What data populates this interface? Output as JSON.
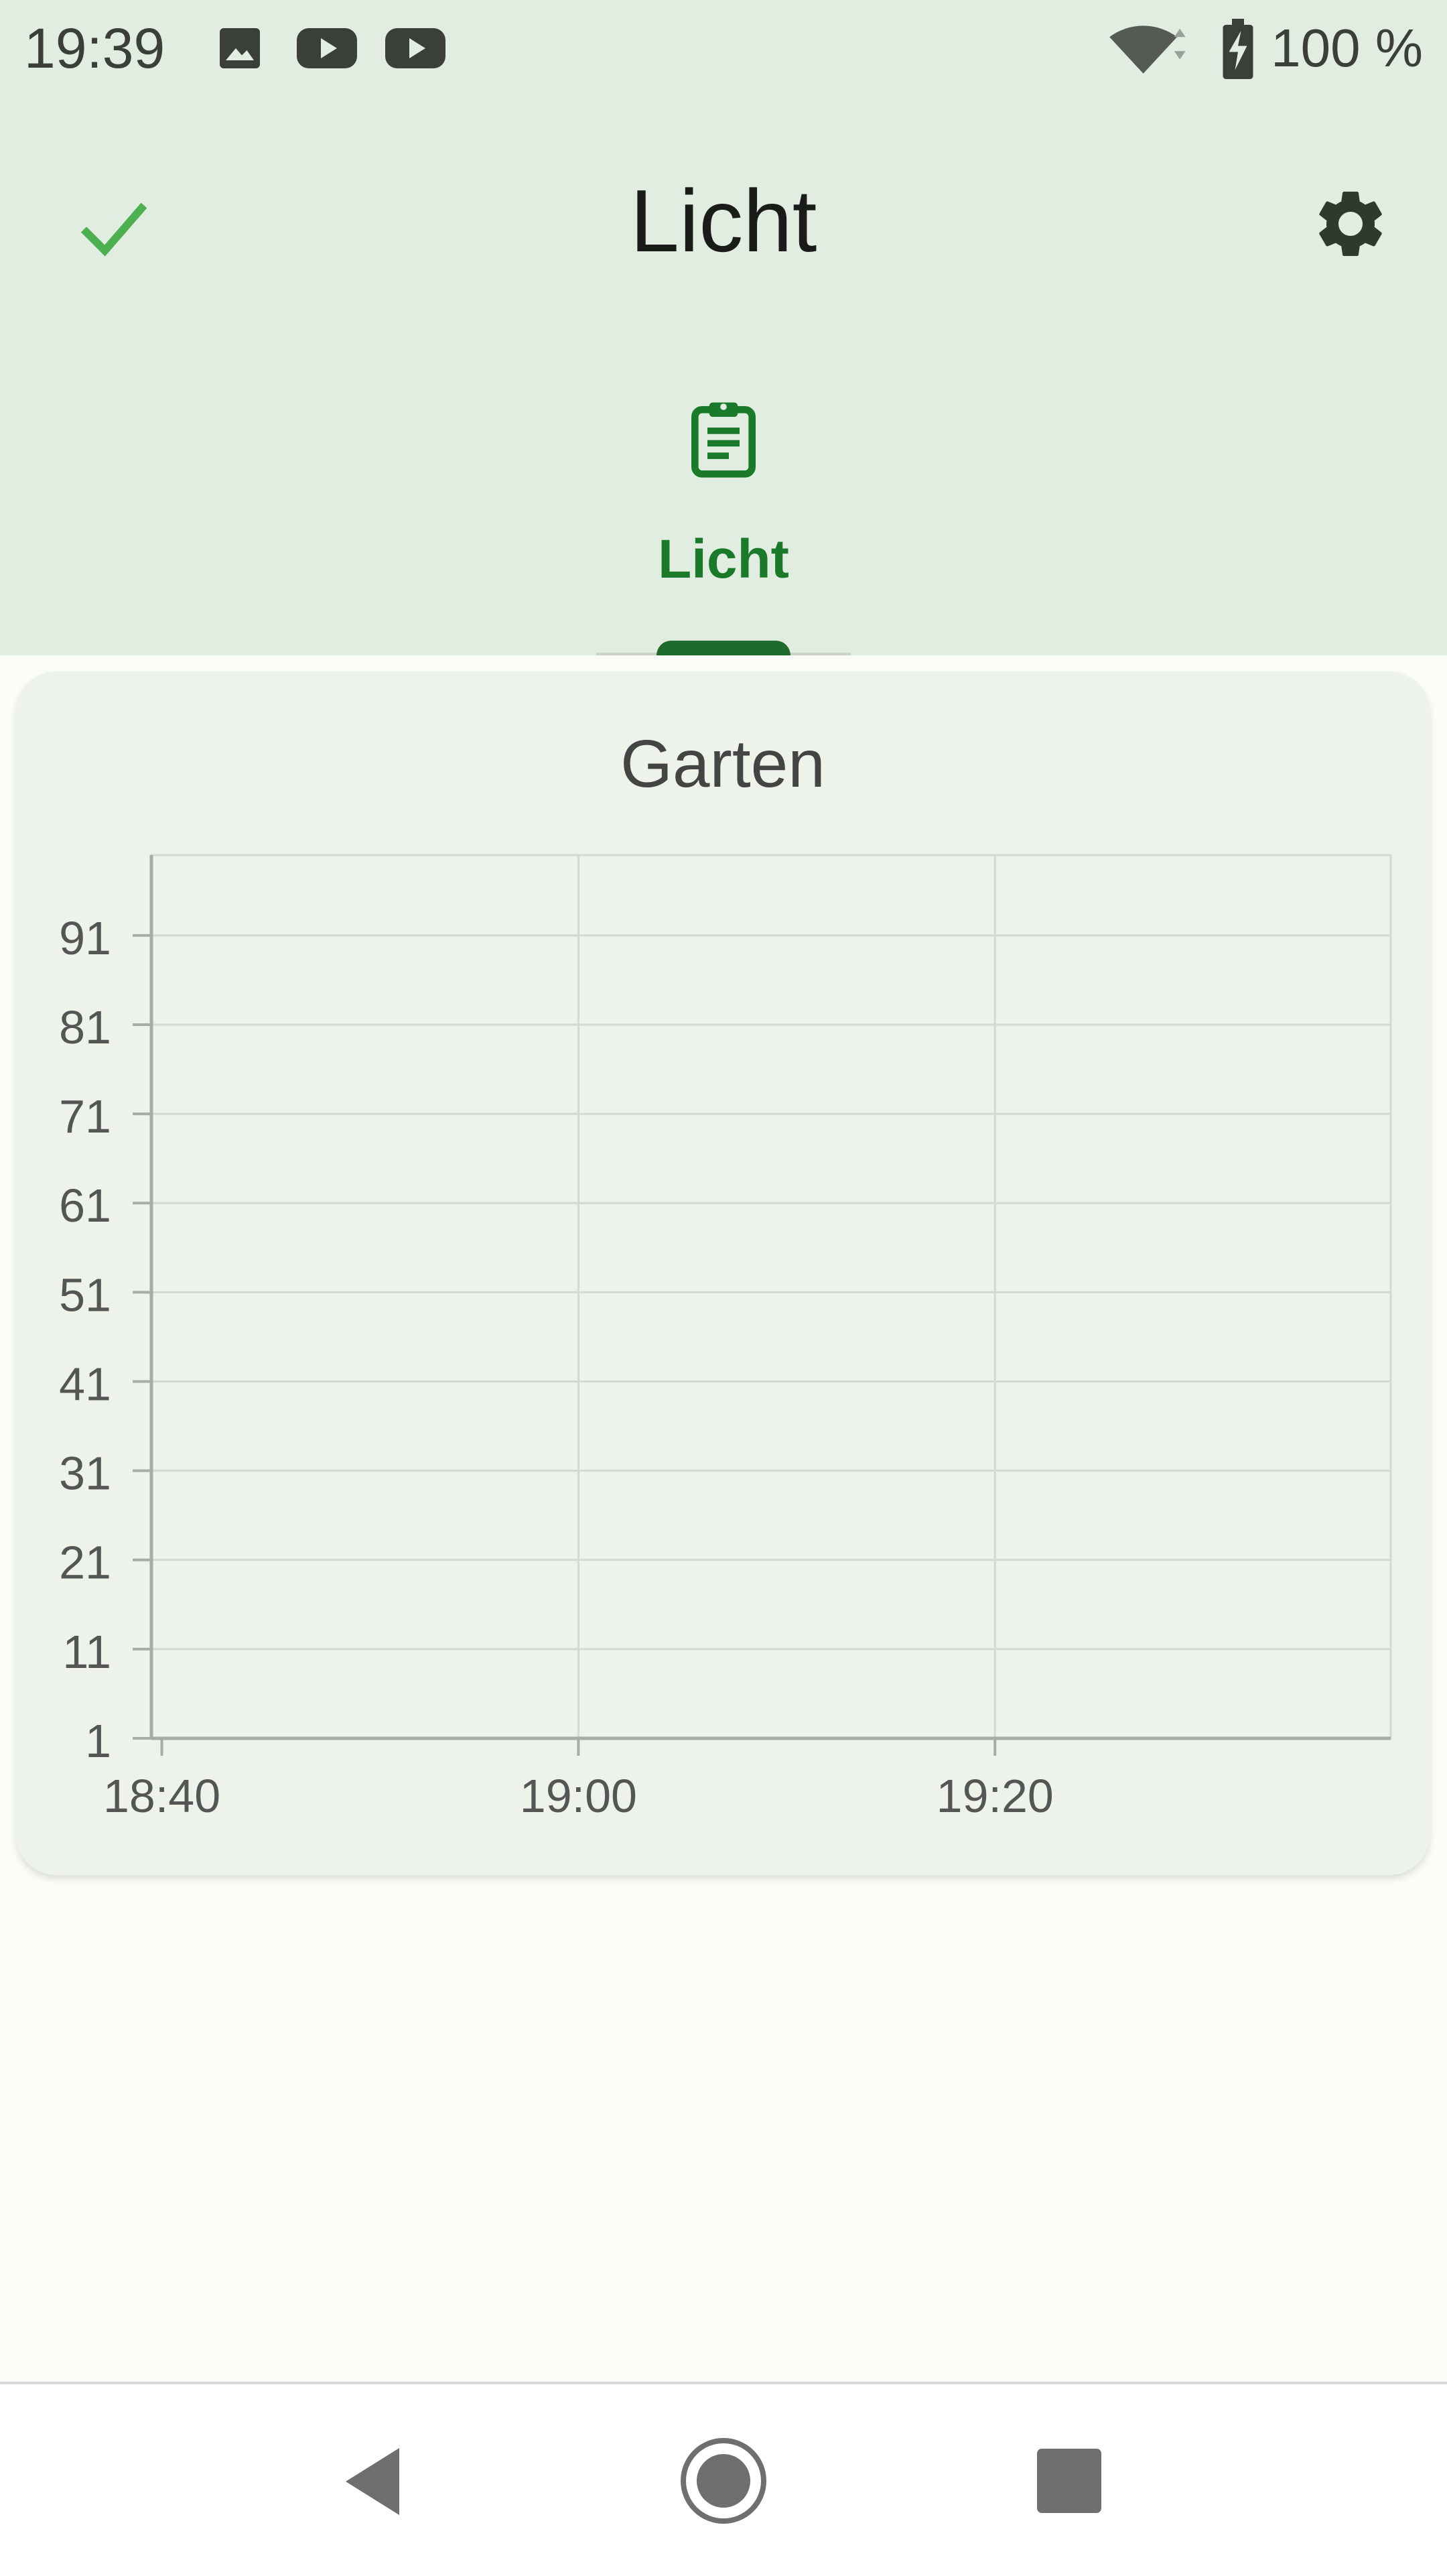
{
  "status_bar": {
    "time": "19:39",
    "notification_icons": [
      "image-icon",
      "youtube-icon",
      "youtube-icon"
    ],
    "wifi_icon": "wifi-icon",
    "battery_icon": "battery-charging-icon",
    "battery_percent": "100 %"
  },
  "app_bar": {
    "title": "Licht",
    "confirm_icon": "check-icon",
    "settings_icon": "gear-icon"
  },
  "tabs": [
    {
      "label": "Licht",
      "icon": "clipboard-icon",
      "selected": true
    }
  ],
  "card": {
    "title": "Garten"
  },
  "chart_data": {
    "type": "line",
    "title": "Garten",
    "xlabel": "",
    "ylabel": "",
    "x_ticks": [
      "18:40",
      "19:00",
      "19:20"
    ],
    "y_ticks": [
      1,
      11,
      21,
      31,
      41,
      51,
      61,
      71,
      81,
      91
    ],
    "xlim": [
      "18:39:30",
      "19:39"
    ],
    "ylim": [
      1,
      100
    ],
    "grid": true,
    "series": []
  },
  "nav_bar": {
    "back_icon": "back-icon",
    "home_icon": "home-icon",
    "recents_icon": "recents-icon"
  },
  "colors": {
    "header_background": "#e2ede1",
    "accent": "#1a7a2a",
    "check": "#4caf50",
    "card_background": "#edf3ea"
  }
}
